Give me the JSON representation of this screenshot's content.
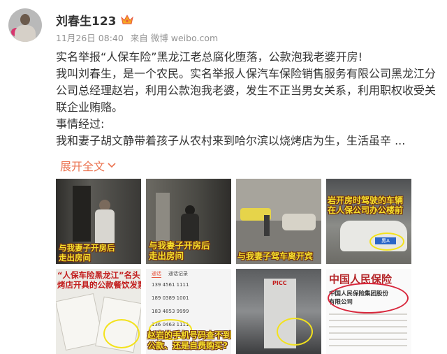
{
  "post": {
    "author": {
      "name": "刘春生123",
      "badge_icon": "crown-icon"
    },
    "meta": {
      "time": "11月26日 08:40",
      "via": "来自 微博 weibo.com"
    },
    "content": [
      "实名举报“人保车险”黑龙江老总腐化堕落，公款泡我老婆开房!",
      "我叫刘春生，是一个农民。实名举报人保汽车保险销售服务有限公司黑龙江分公司总经理赵岩，利用公款泡我老婆，发生不正当男女关系，利用职权收受关联企业贿赂。",
      "事情经过:",
      "我和妻子胡文静带着孩子从农村来到哈尔滨以烧烤店为生，生活虽辛 ..."
    ],
    "expand_label": "展开全文",
    "images": [
      {
        "caption": "与我妻子开房后\n走出房间"
      },
      {
        "caption": "与我妻子开房后\n走出房间"
      },
      {
        "caption": "与我妻子驾车离开宾"
      },
      {
        "caption": "岩开房时驾驶的车辆\n在人保公司办公楼前",
        "plate": "黑A"
      },
      {
        "caption": "“人保车险黑龙江”名头\n烤店开具的公款餐饮发票存"
      },
      {
        "caption": "赵岩的手机号码查不到\n公款、还是自费购买?",
        "tabs": [
          "通话",
          "通话记录"
        ],
        "numbers": [
          "139 4561 1111",
          "189 0389 1001",
          "183 4853 9999",
          "136 0463 1111"
        ]
      },
      {
        "sign": "PICC"
      },
      {
        "title": "中国人民保险",
        "subtitle": "中国人民保险集团股份\n有限公司"
      }
    ]
  }
}
